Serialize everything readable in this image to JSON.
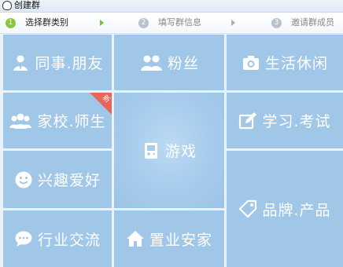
{
  "window": {
    "title": "创建群"
  },
  "steps": [
    {
      "num": "1",
      "label": "选择群类别",
      "active": true
    },
    {
      "num": "2",
      "label": "填写群信息",
      "active": false
    },
    {
      "num": "3",
      "label": "邀请群成员",
      "active": false
    }
  ],
  "categories": {
    "colleagues": {
      "label": "同事.朋友",
      "icon": "person-icon"
    },
    "fans": {
      "label": "粉丝",
      "icon": "people-icon"
    },
    "life": {
      "label": "生活休闲",
      "icon": "camera-icon"
    },
    "school": {
      "label": "家校.师生",
      "icon": "group-icon",
      "badge": "新"
    },
    "game": {
      "label": "游戏",
      "icon": "gamepad-icon"
    },
    "study": {
      "label": "学习.考试",
      "icon": "pencil-icon"
    },
    "interest": {
      "label": "兴趣爱好",
      "icon": "smile-icon"
    },
    "brand": {
      "label": "品牌.产品",
      "icon": "tag-icon"
    },
    "industry": {
      "label": "行业交流",
      "icon": "chat-bubble-icon"
    },
    "property": {
      "label": "置业安家",
      "icon": "house-icon"
    }
  },
  "colors": {
    "tile": "#a0c6e8",
    "active_step": "#8cc63f",
    "badge": "#e8655a"
  }
}
